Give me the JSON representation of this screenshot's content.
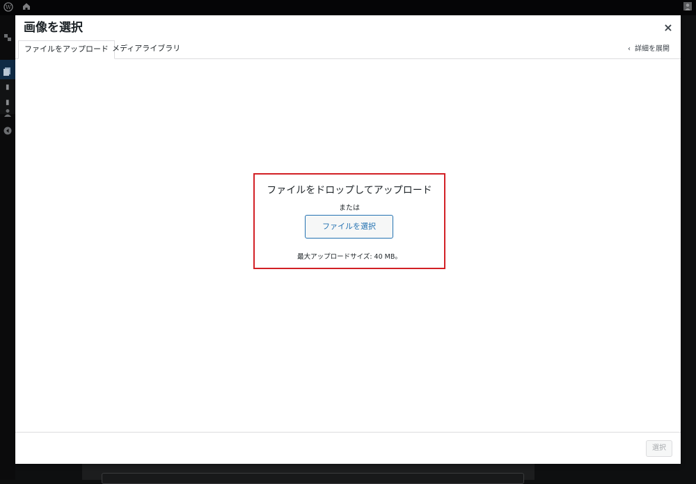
{
  "modal": {
    "title": "画像を選択",
    "close_label": "×",
    "tabs": [
      {
        "label": "ファイルをアップロード",
        "active": true
      },
      {
        "label": "メディアライブラリ",
        "active": false
      }
    ],
    "expand_link": "詳細を展開",
    "upload": {
      "drop_text": "ファイルをドロップしてアップロード",
      "or_text": "または",
      "select_file_label": "ファイルを選択",
      "max_size": "最大アップロードサイズ: 40 MB。"
    },
    "footer": {
      "select_label": "選択"
    }
  },
  "icons": {
    "wordpress": "wordpress-logo-icon",
    "home": "home-icon",
    "user": "user-icon",
    "collapse": "collapse-icon",
    "pages": "pages-icon",
    "plugin": "plugin-icon",
    "chevron": "chevron-left-icon",
    "close": "close-icon"
  },
  "colors": {
    "accent": "#2271b1",
    "highlight_border": "#d21f24"
  }
}
